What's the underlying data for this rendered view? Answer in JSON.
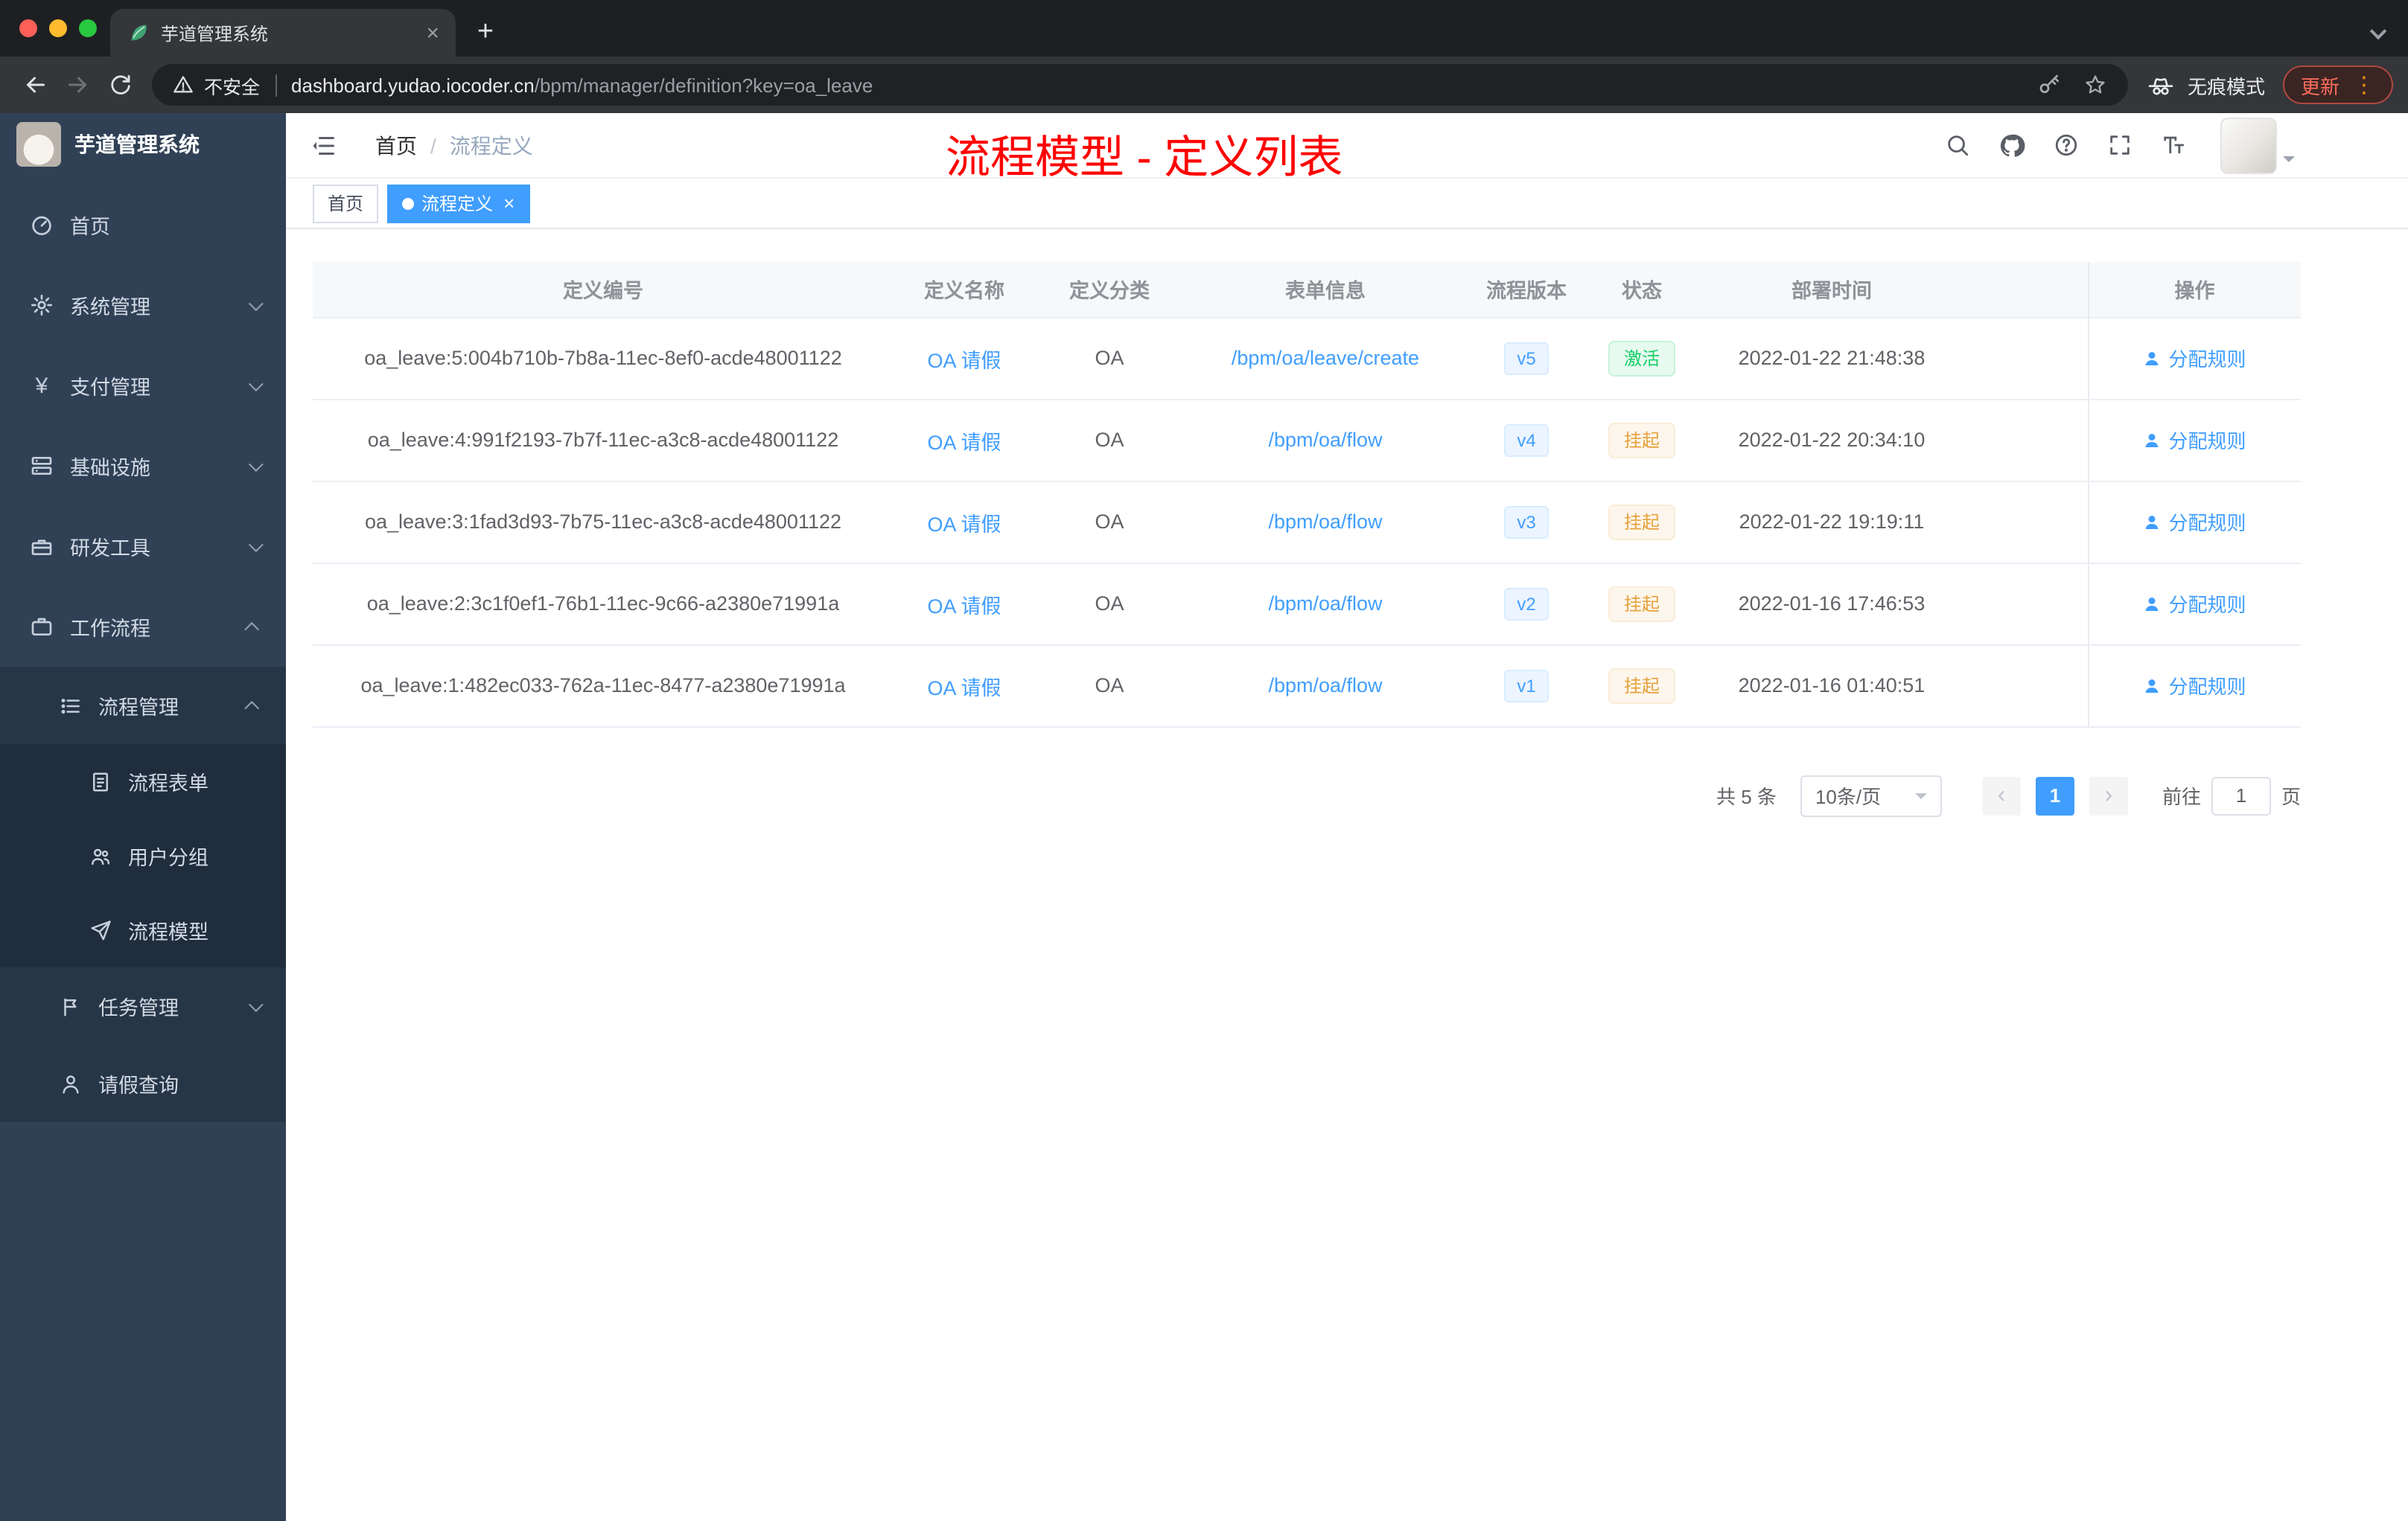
{
  "browser": {
    "tab_title": "芋道管理系统",
    "security_label": "不安全",
    "url_domain": "dashboard.yudao.iocoder.cn",
    "url_path": "/bpm/manager/definition?key=oa_leave",
    "incognito_label": "无痕模式",
    "update_label": "更新"
  },
  "icons": {
    "close": "×",
    "plus": "+",
    "dots": "⋮",
    "prev": "‹",
    "next": "›",
    "yen": "¥"
  },
  "sidebar": {
    "logo_title": "芋道管理系统",
    "items": [
      {
        "icon": "dashboard-icon",
        "label": "首页",
        "depth": 0
      },
      {
        "icon": "gear-icon",
        "label": "系统管理",
        "depth": 0,
        "chevron": "down"
      },
      {
        "icon": "yen-icon",
        "label": "支付管理",
        "depth": 0,
        "chevron": "down"
      },
      {
        "icon": "server-icon",
        "label": "基础设施",
        "depth": 0,
        "chevron": "down"
      },
      {
        "icon": "toolbox-icon",
        "label": "研发工具",
        "depth": 0,
        "chevron": "down"
      },
      {
        "icon": "briefcase-icon",
        "label": "工作流程",
        "depth": 0,
        "chevron": "up"
      },
      {
        "icon": "list-icon",
        "label": "流程管理",
        "depth": 1,
        "chevron": "up"
      },
      {
        "icon": "form-icon",
        "label": "流程表单",
        "depth": 2
      },
      {
        "icon": "users-icon",
        "label": "用户分组",
        "depth": 2
      },
      {
        "icon": "paper-plane-icon",
        "label": "流程模型",
        "depth": 2
      },
      {
        "icon": "flag-icon",
        "label": "任务管理",
        "depth": 1,
        "chevron": "down"
      },
      {
        "icon": "person-icon",
        "label": "请假查询",
        "depth": 1
      }
    ]
  },
  "header": {
    "breadcrumb_home": "首页",
    "breadcrumb_sep": "/",
    "breadcrumb_current": "流程定义",
    "annotation": "流程模型 - 定义列表"
  },
  "tags": [
    {
      "label": "首页",
      "active": false
    },
    {
      "label": "流程定义",
      "active": true
    }
  ],
  "table": {
    "columns": [
      "定义编号",
      "定义名称",
      "定义分类",
      "表单信息",
      "流程版本",
      "状态",
      "部署时间",
      "操作"
    ],
    "rows": [
      {
        "id": "oa_leave:5:004b710b-7b8a-11ec-8ef0-acde48001122",
        "name": "OA 请假",
        "category": "OA",
        "form": "/bpm/oa/leave/create",
        "version": "v5",
        "status": "激活",
        "status_type": "success",
        "deploy_time": "2022-01-22 21:48:38",
        "action": "分配规则"
      },
      {
        "id": "oa_leave:4:991f2193-7b7f-11ec-a3c8-acde48001122",
        "name": "OA 请假",
        "category": "OA",
        "form": "/bpm/oa/flow",
        "version": "v4",
        "status": "挂起",
        "status_type": "warning",
        "deploy_time": "2022-01-22 20:34:10",
        "action": "分配规则"
      },
      {
        "id": "oa_leave:3:1fad3d93-7b75-11ec-a3c8-acde48001122",
        "name": "OA 请假",
        "category": "OA",
        "form": "/bpm/oa/flow",
        "version": "v3",
        "status": "挂起",
        "status_type": "warning",
        "deploy_time": "2022-01-22 19:19:11",
        "action": "分配规则"
      },
      {
        "id": "oa_leave:2:3c1f0ef1-76b1-11ec-9c66-a2380e71991a",
        "name": "OA 请假",
        "category": "OA",
        "form": "/bpm/oa/flow",
        "version": "v2",
        "status": "挂起",
        "status_type": "warning",
        "deploy_time": "2022-01-16 17:46:53",
        "action": "分配规则"
      },
      {
        "id": "oa_leave:1:482ec033-762a-11ec-8477-a2380e71991a",
        "name": "OA 请假",
        "category": "OA",
        "form": "/bpm/oa/flow",
        "version": "v1",
        "status": "挂起",
        "status_type": "warning",
        "deploy_time": "2022-01-16 01:40:51",
        "action": "分配规则"
      }
    ]
  },
  "pagination": {
    "total": "共 5 条",
    "page_size": "10条/页",
    "current_page": "1",
    "goto_label": "前往",
    "goto_value": "1",
    "goto_unit": "页"
  },
  "colors": {
    "accent": "#409eff",
    "success": "#13ce66",
    "warning": "#e6a23c",
    "annotation_red": "#ff0000",
    "sidebar_bg": "#304156"
  }
}
